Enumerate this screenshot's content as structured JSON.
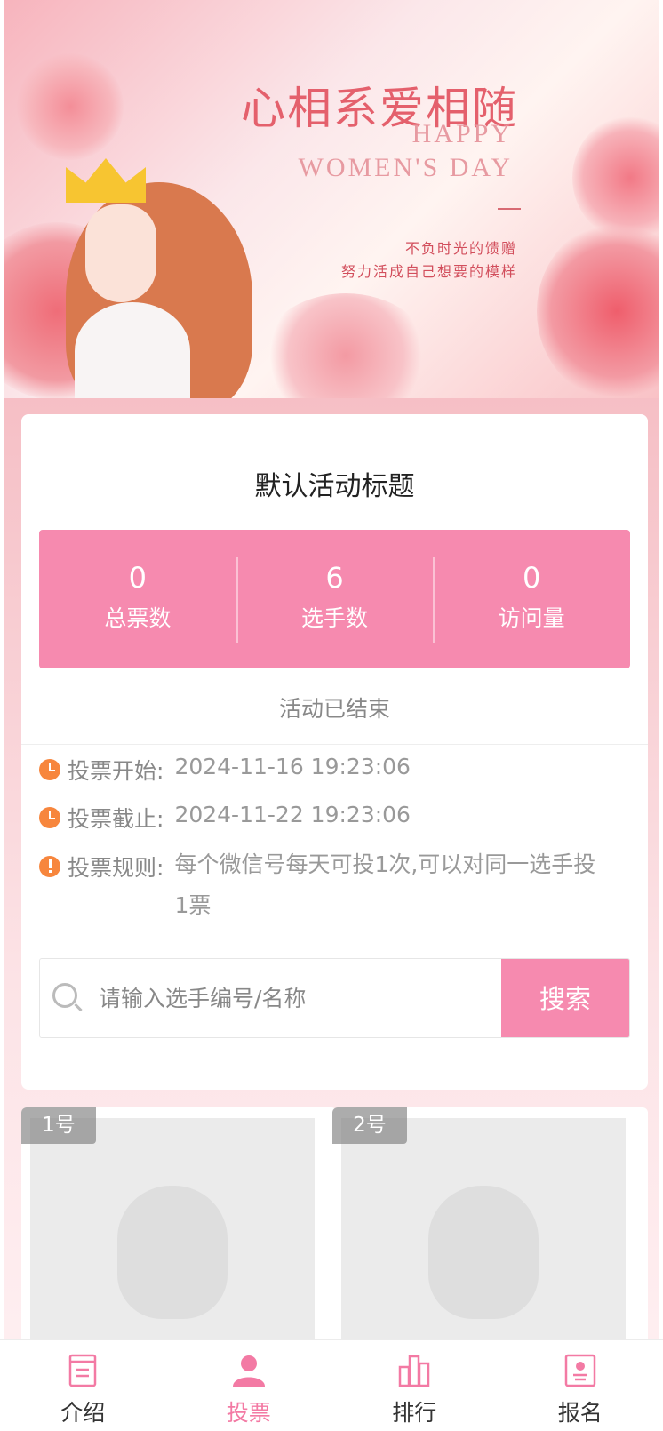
{
  "banner": {
    "title_cn": "心相系爱相随",
    "title_en_1": "HAPPY",
    "title_en_2": "WOMEN'S DAY",
    "slogan_1": "不负时光的馈赠",
    "slogan_2": "努力活成自己想要的模样"
  },
  "activity": {
    "title": "默认活动标题",
    "status": "活动已结束",
    "stats": [
      {
        "value": "0",
        "label": "总票数"
      },
      {
        "value": "6",
        "label": "选手数"
      },
      {
        "value": "0",
        "label": "访问量"
      }
    ],
    "info": {
      "start_label": "投票开始:",
      "start_value": "2024-11-16 19:23:06",
      "end_label": "投票截止:",
      "end_value": "2024-11-22 19:23:06",
      "rules_label": "投票规则:",
      "rules_value": "每个微信号每天可投1次,可以对同一选手投1票"
    }
  },
  "search": {
    "placeholder": "请输入选手编号/名称",
    "button_label": "搜索"
  },
  "contestants": [
    {
      "tag": "1号"
    },
    {
      "tag": "2号"
    }
  ],
  "tabbar": {
    "items": [
      {
        "label": "介绍",
        "icon": "document-icon"
      },
      {
        "label": "投票",
        "icon": "person-icon"
      },
      {
        "label": "排行",
        "icon": "bar-chart-icon"
      },
      {
        "label": "报名",
        "icon": "id-card-icon"
      }
    ],
    "active_index": 1
  },
  "colors": {
    "accent": "#f68aaf",
    "active_tab": "#f37aa4",
    "info_icon": "#f7863d"
  }
}
